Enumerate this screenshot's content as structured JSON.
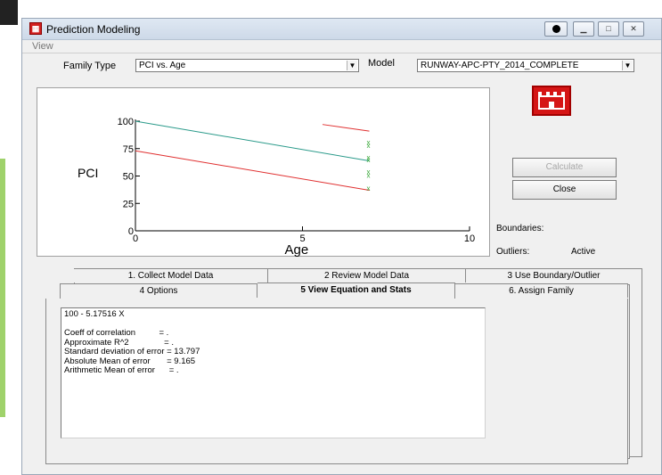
{
  "window": {
    "title": "Prediction Modeling",
    "app_icon_char": "▦",
    "menu": {
      "view": "View"
    }
  },
  "controls": {
    "family_type_label": "Family Type",
    "family_type_value": "PCI vs. Age",
    "model_label": "Model",
    "model_value": "RUNWAY-APC-PTY_2014_COMPLETE"
  },
  "buttons": {
    "calculate": "Calculate",
    "close": "Close"
  },
  "status": {
    "boundaries_label": "Boundaries:",
    "boundaries_value": "",
    "outliers_label": "Outliers:",
    "outliers_value": "Active"
  },
  "tabs": {
    "row1": [
      "1. Collect Model Data",
      "2 Review Model Data",
      "3 Use Boundary/Outlier"
    ],
    "row2": [
      "4 Options",
      "5 View Equation and Stats",
      "6. Assign Family"
    ],
    "active": "5 View Equation and Stats"
  },
  "stats": {
    "equation": "100 - 5.17516 X",
    "lines": [
      "Coeff of correlation          = .",
      "Approximate R^2               = .",
      "Standard deviation of error = 13.797",
      "Absolute Mean of error       = 9.165",
      "Arithmetic Mean of error      = ."
    ]
  },
  "colors": {
    "teal_line": "#2a9a8a",
    "red_line": "#e03030",
    "points": "#3aa83a"
  },
  "chart_data": {
    "type": "line",
    "xlabel": "Age",
    "ylabel": "PCI",
    "xlim": [
      0,
      10
    ],
    "ylim": [
      0,
      100
    ],
    "x_ticks": [
      0,
      5,
      10
    ],
    "y_ticks": [
      0,
      25,
      50,
      75,
      100
    ],
    "series": [
      {
        "name": "",
        "color": "#2a9a8a",
        "x": [
          0,
          7
        ],
        "y": [
          100,
          63.8
        ]
      },
      {
        "name": "",
        "color": "#e03030",
        "x": [
          0,
          7
        ],
        "y": [
          73,
          37
        ]
      },
      {
        "name": "",
        "color": "#e03030",
        "x": [
          5.6,
          7
        ],
        "y": [
          97,
          91
        ]
      }
    ],
    "points": [
      {
        "x": 7,
        "y": 81
      },
      {
        "x": 7,
        "y": 78
      },
      {
        "x": 7,
        "y": 67
      },
      {
        "x": 7,
        "y": 65
      },
      {
        "x": 7,
        "y": 54
      },
      {
        "x": 7,
        "y": 51
      },
      {
        "x": 7,
        "y": 39
      }
    ]
  }
}
